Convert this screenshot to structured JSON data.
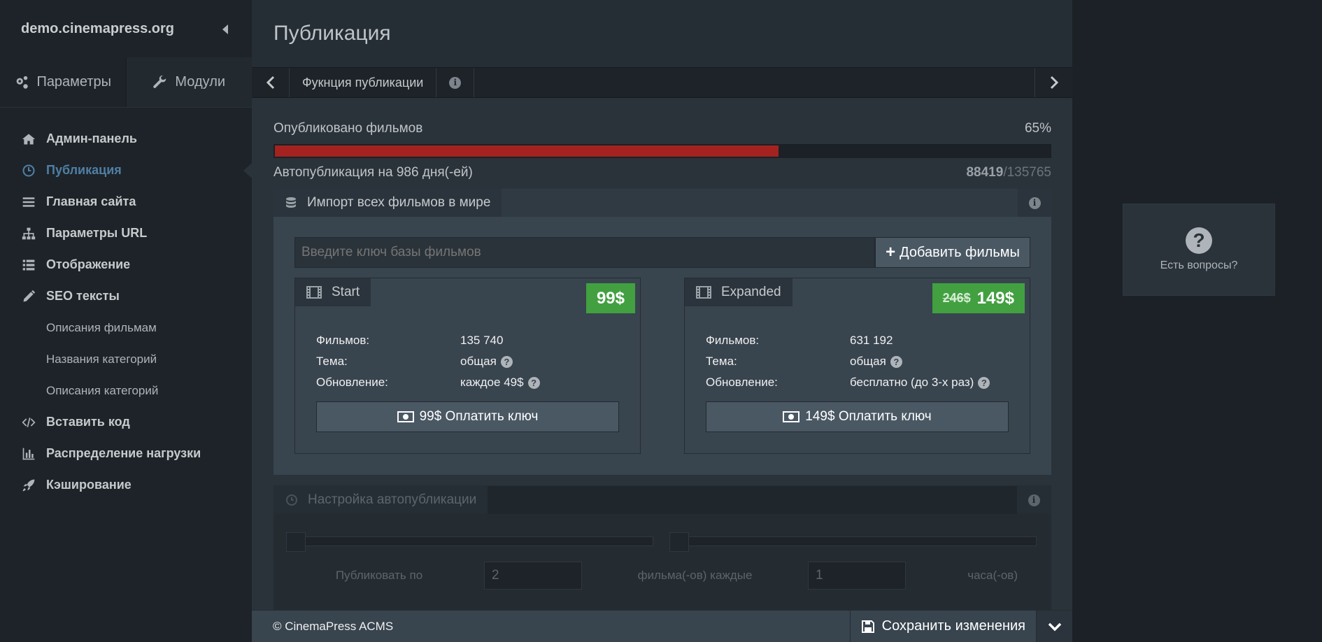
{
  "sidebar": {
    "brand": "demo.cinemapress.org",
    "tabs": [
      {
        "label": "Параметры",
        "icon": "gears-icon"
      },
      {
        "label": "Модули",
        "icon": "wrench-icon"
      }
    ],
    "items": [
      {
        "label": "Админ-панель",
        "icon": "home-icon"
      },
      {
        "label": "Публикация",
        "icon": "clock-icon",
        "active": true
      },
      {
        "label": "Главная сайта",
        "icon": "bars-icon"
      },
      {
        "label": "Параметры URL",
        "icon": "sitemap-icon"
      },
      {
        "label": "Отображение",
        "icon": "list-icon"
      },
      {
        "label": "SEO тексты",
        "icon": "pencil-icon"
      }
    ],
    "subitems": [
      "Описания фильмам",
      "Названия категорий",
      "Описания категорий"
    ],
    "items2": [
      {
        "label": "Вставить код",
        "icon": "code-icon"
      },
      {
        "label": "Распределение нагрузки",
        "icon": "bar-chart-icon"
      },
      {
        "label": "Кэширование",
        "icon": "rocket-icon"
      }
    ]
  },
  "main": {
    "title": "Публикация",
    "crumb": "Фукнция публикации",
    "progress": {
      "label": "Опубликовано фильмов",
      "percent_text": "65%",
      "fraction": 0.65,
      "auto_text": "Автопубликация на 986 дня(-ей)",
      "published": "88419",
      "total": "/135765"
    },
    "import_panel": {
      "title": "Импорт всех фильмов в мире",
      "key_placeholder": "Введите ключ базы фильмов",
      "add_button": "Добавить фильмы",
      "plans": [
        {
          "name": "Start",
          "old_price": "",
          "price": "99$",
          "specs": [
            {
              "label": "Фильмов:",
              "value": "135 740",
              "help": false
            },
            {
              "label": "Тема:",
              "value": "общая",
              "help": true
            },
            {
              "label": "Обновление:",
              "value": "каждое 49$",
              "help": true
            }
          ],
          "pay_button": "99$ Оплатить ключ"
        },
        {
          "name": "Expanded",
          "old_price": "246$",
          "price": "149$",
          "specs": [
            {
              "label": "Фильмов:",
              "value": "631 192",
              "help": false
            },
            {
              "label": "Тема:",
              "value": "общая",
              "help": true
            },
            {
              "label": "Обновление:",
              "value": "бесплатно (до 3-х раз)",
              "help": true
            }
          ],
          "pay_button": "149$ Оплатить ключ"
        }
      ]
    },
    "autopub_panel": {
      "title": "Настройка автопубликации",
      "label_publish": "Публиковать по",
      "count_value": "2",
      "label_every": "фильма(-ов) каждые",
      "hours_value": "1",
      "label_hours": "часа(-ов)"
    }
  },
  "footer": {
    "copyright": "© CinemaPress ACMS",
    "save_button": "Сохранить изменения"
  },
  "help": {
    "text": "Есть вопросы?"
  },
  "colors": {
    "accent": "#4f7fa5",
    "progress": "#a4221f",
    "price": "#42a041"
  }
}
